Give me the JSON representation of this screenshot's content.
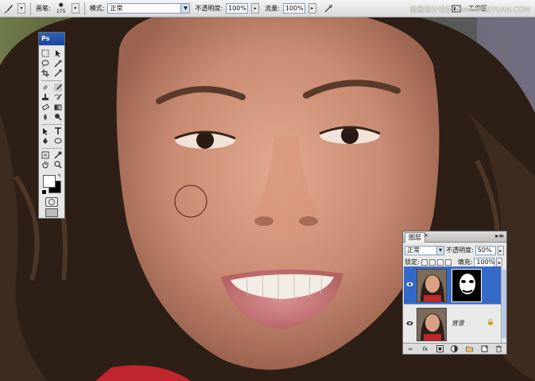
{
  "options_bar": {
    "brush_label": "画笔:",
    "brush_size": "175",
    "mode_label": "模式:",
    "mode_value": "正常",
    "opacity_label": "不透明度:",
    "opacity_value": "100%",
    "flow_label": "流量:",
    "flow_value": "100%",
    "workspace_label": "工作区"
  },
  "watermark": "思缘设计论坛 www.MISSYUAN.COM",
  "tools_panel": {
    "title": "Ps"
  },
  "layers_panel": {
    "tab_label": "图层",
    "close_glyph": "×",
    "blend_mode": "正常",
    "opacity_label": "不透明度:",
    "opacity_value": "50%",
    "lock_label": "锁定:",
    "fill_label": "填充:",
    "fill_value": "100%",
    "layers": [
      {
        "name": "",
        "selected": true,
        "has_mask": true
      },
      {
        "name": "背景",
        "selected": false,
        "has_mask": false
      }
    ]
  },
  "colors": {
    "selection": "#3569c8",
    "title_bar": "#1b449a"
  }
}
